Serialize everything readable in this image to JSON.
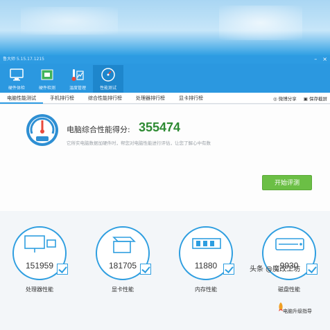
{
  "window": {
    "title": "鲁大师 5.15.17.1215"
  },
  "toolbar": {
    "items": [
      {
        "label": "硬件体检"
      },
      {
        "label": "硬件检测"
      },
      {
        "label": "温度管理"
      },
      {
        "label": "性能测试"
      }
    ]
  },
  "tabs": {
    "items": [
      {
        "label": "电脑性能测试"
      },
      {
        "label": "手机排行榜"
      },
      {
        "label": "综合性能排行榜"
      },
      {
        "label": "处理器排行榜"
      },
      {
        "label": "显卡排行榜"
      }
    ],
    "share_label": "微博分享",
    "save_label": "保存截屏"
  },
  "score": {
    "label": "电脑综合性能得分:",
    "value": "355474",
    "subtitle": "它所实电脑数据加硬件时，帮您对电脑性能进行评估，让您了解心中有数",
    "start_button": "开始评测"
  },
  "cards": [
    {
      "value": "151959",
      "label": "处理器性能"
    },
    {
      "value": "181705",
      "label": "显卡性能"
    },
    {
      "value": "11880",
      "label": "内存性能"
    },
    {
      "value": "9930",
      "label": "磁盘性能"
    }
  ],
  "upgrade_label": "电脑升级指导",
  "watermark": "头条 @魔改工坊",
  "colors": {
    "accent": "#2d9be2",
    "score": "#2d8a32",
    "start_button": "#6bbf45"
  }
}
